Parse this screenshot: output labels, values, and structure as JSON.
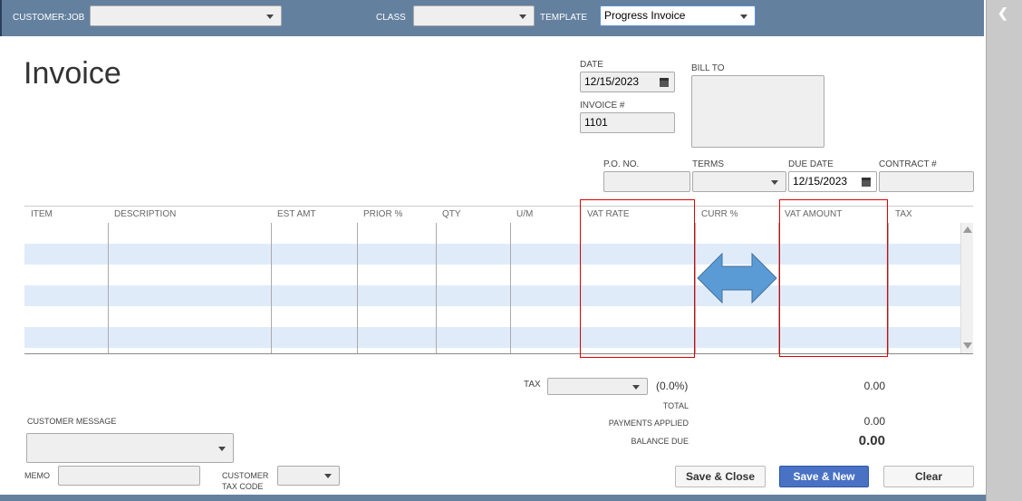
{
  "header": {
    "customer_job_label": "CUSTOMER:JOB",
    "customer_job_value": "",
    "class_label": "CLASS",
    "class_value": "",
    "template_label": "TEMPLATE",
    "template_value": "Progress Invoice"
  },
  "form": {
    "title": "Invoice",
    "date_label": "DATE",
    "date_value": "12/15/2023",
    "invoice_no_label": "INVOICE #",
    "invoice_no_value": "1101",
    "bill_to_label": "BILL TO",
    "po_label": "P.O. NO.",
    "terms_label": "TERMS",
    "due_date_label": "DUE DATE",
    "due_date_value": "12/15/2023",
    "contract_label": "CONTRACT #"
  },
  "table": {
    "columns": [
      "ITEM",
      "DESCRIPTION",
      "EST AMT",
      "PRIOR %",
      "QTY",
      "U/M",
      "VAT RATE",
      "CURR %",
      "VAT AMOUNT",
      "TAX"
    ],
    "row_count": 6
  },
  "totals": {
    "tax_label": "TAX",
    "tax_rate": "(0.0%)",
    "tax_amount": "0.00",
    "total_label": "TOTAL",
    "payments_label": "PAYMENTS APPLIED",
    "payments_value": "0.00",
    "balance_label": "BALANCE DUE",
    "balance_value": "0.00"
  },
  "footer": {
    "customer_message_label": "CUSTOMER MESSAGE",
    "memo_label": "MEMO",
    "tax_code_label_1": "CUSTOMER",
    "tax_code_label_2": "TAX CODE",
    "save_close": "Save & Close",
    "save_new": "Save & New",
    "clear": "Clear"
  },
  "colors": {
    "topbar": "#64809f",
    "row_alt": "#e0ebfa",
    "primary": "#4a72c4",
    "highlight": "#e00000",
    "arrow": "#5b9bd5"
  }
}
